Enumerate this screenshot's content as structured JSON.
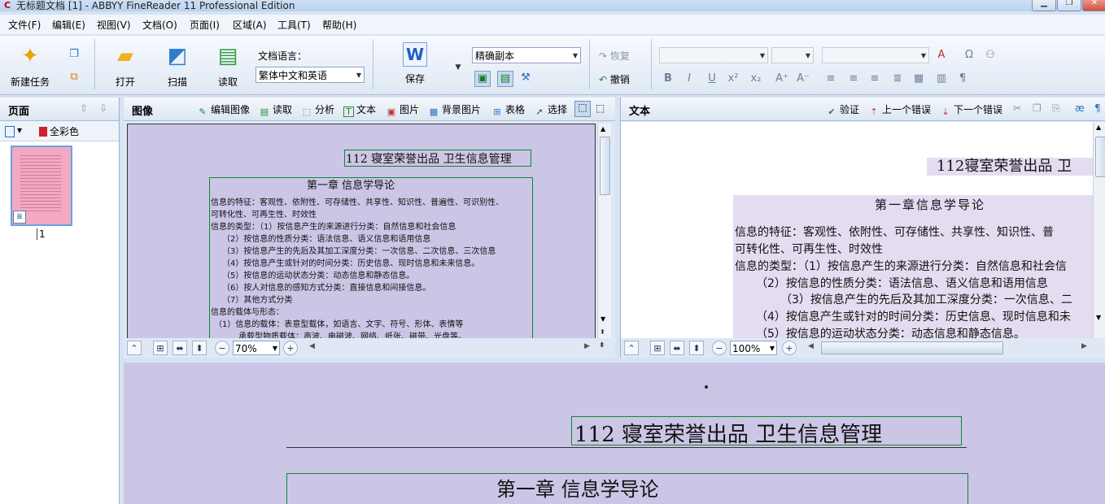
{
  "window": {
    "title": "无标题文档 [1] - ABBYY FineReader 11 Professional Edition",
    "app_icon_glyph": "C",
    "minimize_glyph": "▁",
    "maximize_glyph": "❐",
    "close_glyph": "✕"
  },
  "menu": [
    "文件(F)",
    "编辑(E)",
    "视图(V)",
    "文档(O)",
    "页面(I)",
    "区域(A)",
    "工具(T)",
    "帮助(H)"
  ],
  "toolbar": {
    "new_task": "新建任务",
    "open": "打开",
    "scan": "扫描",
    "read": "读取",
    "doc_lang_label": "文档语言：",
    "doc_lang_value": "繁体中文和英语",
    "save": "保存",
    "save_mode": "精确副本",
    "redo": "恢复",
    "undo": "撤销",
    "word_badge": "W"
  },
  "pages_pane": {
    "title": "页面",
    "color_mode": "全彩色",
    "page_number": "1"
  },
  "image_pane": {
    "title": "图像",
    "buttons": [
      "编辑图像",
      "读取",
      "分析",
      "文本",
      "图片",
      "背景图片",
      "表格",
      "选择"
    ],
    "zoom": "70%"
  },
  "text_pane": {
    "title": "文本",
    "buttons": [
      "验证",
      "上一个错误",
      "下一个错误"
    ],
    "zoom": "100%",
    "lines": [
      "112寝室荣誉出品 卫",
      "第一章信息学导论",
      "信息的特征：客观性、依附性、可存储性、共享性、知识性、普",
      "可转化性、可再生性、时效性",
      "信息的类型：（1）按信息产生的来源进行分类：自然信息和社会信",
      "（2）按信息的性质分类：语法信息、语义信息和语用信息",
      "（3）按信息产生的先后及其加工深度分类：一次信息、二",
      "（4）按信息产生或针对的时间分类：历史信息、现时信息和未",
      "（5）按信息的运动状态分类：动态信息和静态信息。"
    ]
  },
  "document_image": {
    "header": "112 寝室荣誉出品    卫生信息管理",
    "chapter": "第一章    信息学导论",
    "lines": [
      "信息的特征：客观性、依附性、可存储性、共享性、知识性、普遍性、可识别性、",
      "可转化性、可再生性、时效性",
      "信息的类型：（1）按信息产生的来源进行分类：自然信息和社会信息",
      "（2）按信息的性质分类：语法信息、语义信息和语用信息",
      "（3）按信息产生的先后及其加工深度分类：一次信息、二次信息、三次信息",
      "（4）按信息产生或针对的时间分类：历史信息、现时信息和未来信息。",
      "（5）按信息的运动状态分类：动态信息和静态信息。",
      "（6）按人对信息的感知方式分类：直接信息和间接信息。",
      "（7）其他方式分类",
      "信息的载体与形态：",
      "（1）信息的载体：表意型载体，如语言、文字、符号、形体、表情等",
      "承载型物质载体：声波、电磁波、网络、纸张、磁带、光盘等。"
    ]
  },
  "zoom_pane": {
    "header": "112 寝室荣誉出品    卫生信息管理",
    "chapter": "第一章    信息学导论"
  },
  "colors": {
    "page_tint": "#cbc6e6",
    "region_border": "#0b8a2e",
    "text_highlight": "#e4dcf0",
    "accent_red": "#c00000"
  }
}
